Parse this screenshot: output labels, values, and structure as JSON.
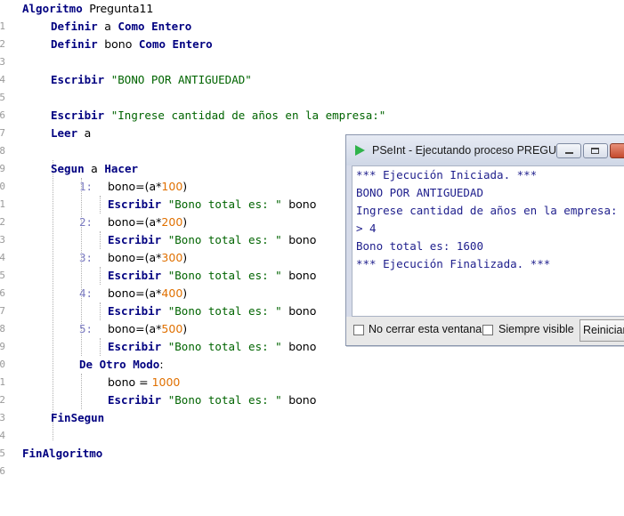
{
  "editor": {
    "line_numbers": [
      "1",
      "2",
      "3",
      "4",
      "5",
      "6",
      "7",
      "8",
      "9",
      "0",
      "1",
      "2",
      "3",
      "4",
      "5",
      "6",
      "7",
      "8",
      "9",
      "0",
      "1",
      "2",
      "3",
      "4",
      "5",
      "6"
    ],
    "kw_algoritmo": "Algoritmo",
    "algo_name": "Pregunta11",
    "kw_definir": "Definir",
    "var_a": "a",
    "var_bono": "bono",
    "kw_como": "Como",
    "kw_entero": "Entero",
    "kw_escribir": "Escribir",
    "str_titulo": "\"BONO POR ANTIGUEDAD\"",
    "str_ingrese": "\"Ingrese cantidad de años en la empresa:\"",
    "kw_leer": "Leer",
    "kw_segun": "Segun",
    "kw_hacer": "Hacer",
    "case_labels": [
      "1:",
      "2:",
      "3:",
      "4:",
      "5:"
    ],
    "assign_prefix": "bono=(a*",
    "case_numbers": [
      "100",
      "200",
      "300",
      "400",
      "500"
    ],
    "assign_suffix": ")",
    "str_bono_total": "\"Bono total es: \"",
    "kw_de_otro_modo": "De Otro Modo",
    "colon": ":",
    "assign_default_prefix": "bono = ",
    "default_number": "1000",
    "kw_finsegun": "FinSegun",
    "kw_finalgoritmo": "FinAlgoritmo"
  },
  "run_window": {
    "title": "PSeInt - Ejecutando proceso PREGU...",
    "output_lines": [
      "*** Ejecución Iniciada. ***",
      "BONO POR ANTIGUEDAD",
      "Ingrese cantidad de años en la empresa:",
      "> 4",
      "Bono total es: 1600",
      "*** Ejecución Finalizada. ***"
    ],
    "checkbox_no_cerrar": "No cerrar esta ventana",
    "checkbox_siempre_visible": "Siempre visible",
    "button_reiniciar": "Reiniciar"
  },
  "colors": {
    "keyword": "#000080",
    "string": "#006400",
    "number": "#e07000",
    "console_text": "#1e1e8c",
    "accent_green": "#2fb34a"
  }
}
